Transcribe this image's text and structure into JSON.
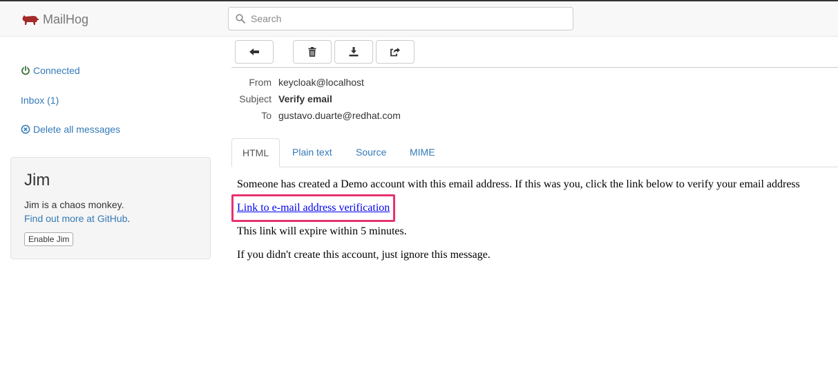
{
  "navbar": {
    "brand": "MailHog",
    "search_placeholder": "Search"
  },
  "sidebar": {
    "connected": "Connected",
    "inbox": "Inbox (1)",
    "delete_all": "Delete all messages"
  },
  "jim": {
    "title": "Jim",
    "description": "Jim is a chaos monkey.",
    "link": "Find out more at GitHub",
    "link_suffix": ".",
    "button": "Enable Jim"
  },
  "message": {
    "from_label": "From",
    "from": "keycloak@localhost",
    "subject_label": "Subject",
    "subject": "Verify email",
    "to_label": "To",
    "to": "gustavo.duarte@redhat.com"
  },
  "tabs": [
    "HTML",
    "Plain text",
    "Source",
    "MIME"
  ],
  "body": {
    "line1": "Someone has created a Demo account with this email address. If this was you, click the link below to verify your email address",
    "link": "Link to e-mail address verification",
    "line3": "This link will expire within 5 minutes.",
    "line4": "If you didn't create this account, just ignore this message."
  },
  "colors": {
    "link": "#337ab7",
    "connected": "#3c763d",
    "brand_icon": "#a52a2a",
    "highlight": "#e6336f"
  }
}
